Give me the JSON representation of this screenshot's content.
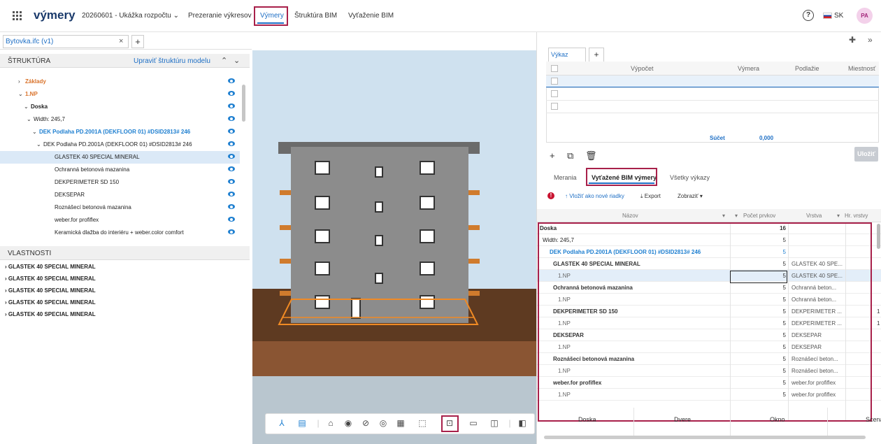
{
  "header": {
    "logo": "výmery",
    "project": "20260601 - Ukážka rozpočtu",
    "nav": [
      "Prezeranie výkresov",
      "Výmery",
      "Štruktúra BIM",
      "Vyťaženie BIM"
    ],
    "lang": "SK",
    "avatar": "PA"
  },
  "file_tab": {
    "name": "Bytovka.ifc (v1)",
    "close": "×",
    "add": "+"
  },
  "structure": {
    "title": "ŠTRUKTÚRA",
    "edit_link": "Upraviť štruktúru modelu",
    "tree": [
      {
        "label": "Základy",
        "color": "#d9722a",
        "bold": true
      },
      {
        "label": "1.NP",
        "color": "#d9722a",
        "bold": true
      },
      {
        "label": "Doska",
        "color": "#222",
        "bold": true
      },
      {
        "label": "Width: 245,7",
        "color": "#222",
        "bold": false
      },
      {
        "label": "DEK Podlaha PD.2001A (DEKFLOOR 01) #DSID2813# 246",
        "color": "#1e7fd0",
        "bold": true
      },
      {
        "label": "DEK Podlaha PD.2001A (DEKFLOOR 01) #DSID2813# 246",
        "color": "#222",
        "bold": false
      },
      {
        "label": "GLASTEK 40 SPECIAL MINERAL",
        "color": "#222",
        "bold": false
      },
      {
        "label": "Ochranná betonová mazanina",
        "color": "#222",
        "bold": false
      },
      {
        "label": "DEKPERIMETER SD 150",
        "color": "#222",
        "bold": false
      },
      {
        "label": "DEKSEPAR",
        "color": "#222",
        "bold": false
      },
      {
        "label": "Roznášecí betonová mazanina",
        "color": "#222",
        "bold": false
      },
      {
        "label": "weber.for profiflex",
        "color": "#222",
        "bold": false
      },
      {
        "label": "Keramická dlažba do interiéru + weber.color comfort",
        "color": "#222",
        "bold": false
      }
    ]
  },
  "properties": {
    "title": "VLASTNOSTI",
    "items": [
      "GLASTEK 40 SPECIAL MINERAL",
      "GLASTEK 40 SPECIAL MINERAL",
      "GLASTEK 40 SPECIAL MINERAL",
      "GLASTEK 40 SPECIAL MINERAL",
      "GLASTEK 40 SPECIAL MINERAL"
    ]
  },
  "calc": {
    "tab": "Výkaz",
    "columns": [
      "Výpočet",
      "Výmera",
      "Podlažie",
      "Miestnosť"
    ],
    "sum_label": "Súčet",
    "sum_value": "0,000",
    "save": "Uložiť"
  },
  "bim": {
    "tabs": [
      "Merania",
      "Vyťažené BIM výmery",
      "Všetky výkazy"
    ],
    "insert_label": "Vložiť ako nové riadky",
    "export_label": "Export",
    "show_label": "Zobraziť",
    "columns": [
      "Názov",
      "Počet prvkov",
      "Vrstva",
      "Hr. vrstvy"
    ],
    "rows": [
      {
        "name": "Doska",
        "count": "16",
        "layer": "",
        "hr": "",
        "style": "group"
      },
      {
        "name": "Width: 245,7",
        "count": "5",
        "layer": "",
        "hr": "",
        "style": "normal"
      },
      {
        "name": "DEK Podlaha PD.2001A (DEKFLOOR 01) #DSID2813# 246",
        "count": "5",
        "layer": "",
        "hr": "",
        "style": "link"
      },
      {
        "name": "GLASTEK 40 SPECIAL MINERAL",
        "count": "5",
        "layer": "GLASTEK 40 SPE...",
        "hr": "",
        "style": "sub"
      },
      {
        "name": "1.NP",
        "count": "5",
        "layer": "GLASTEK 40 SPE...",
        "hr": "",
        "style": "leaf-sel"
      },
      {
        "name": "Ochranná betonová mazanina",
        "count": "5",
        "layer": "Ochranná beton...",
        "hr": "",
        "style": "sub"
      },
      {
        "name": "1.NP",
        "count": "5",
        "layer": "Ochranná beton...",
        "hr": "",
        "style": "leaf"
      },
      {
        "name": "DEKPERIMETER SD 150",
        "count": "5",
        "layer": "DEKPERIMETER ...",
        "hr": "1",
        "style": "sub"
      },
      {
        "name": "1.NP",
        "count": "5",
        "layer": "DEKPERIMETER ...",
        "hr": "1",
        "style": "leaf"
      },
      {
        "name": "DEKSEPAR",
        "count": "5",
        "layer": "DEKSEPAR",
        "hr": "",
        "style": "sub"
      },
      {
        "name": "1.NP",
        "count": "5",
        "layer": "DEKSEPAR",
        "hr": "",
        "style": "leaf"
      },
      {
        "name": "Roznášecí betonová mazanina",
        "count": "5",
        "layer": "Roznášecí beton...",
        "hr": "",
        "style": "sub"
      },
      {
        "name": "1.NP",
        "count": "5",
        "layer": "Roznášecí beton...",
        "hr": "",
        "style": "leaf"
      },
      {
        "name": "weber.for profiflex",
        "count": "5",
        "layer": "weber.for profiflex",
        "hr": "",
        "style": "sub"
      },
      {
        "name": "1.NP",
        "count": "5",
        "layer": "weber.for profiflex",
        "hr": "",
        "style": "leaf"
      }
    ],
    "bottom_tabs": [
      "Doska",
      "Dvere",
      "Okno",
      "Scena"
    ]
  }
}
